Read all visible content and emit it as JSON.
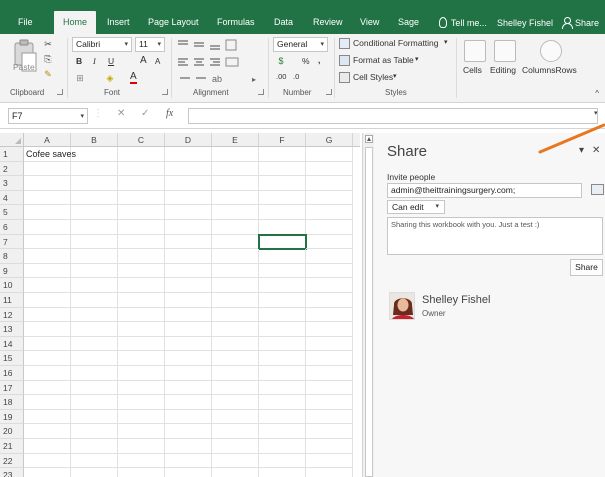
{
  "menubar": {
    "tabs": [
      {
        "label": "File"
      },
      {
        "label": "Home"
      },
      {
        "label": "Insert"
      },
      {
        "label": "Page Layout"
      },
      {
        "label": "Formulas"
      },
      {
        "label": "Data"
      },
      {
        "label": "Review"
      },
      {
        "label": "View"
      },
      {
        "label": "Sage"
      }
    ],
    "active_tab": "Home",
    "tell_me": "Tell me...",
    "user": "Shelley Fishel",
    "share_label": "Share",
    "accent_color": "#217346"
  },
  "ribbon": {
    "clipboard": {
      "paste_label": "Paste",
      "group_label": "Clipboard"
    },
    "font": {
      "font_name": "Calibri",
      "font_size": "11",
      "bold": "B",
      "italic": "I",
      "underline": "U",
      "grow": "A",
      "shrink": "A",
      "font_color_label": "A",
      "group_label": "Font"
    },
    "alignment": {
      "group_label": "Alignment"
    },
    "number": {
      "format": "General",
      "percent": "%",
      "comma": ",",
      "inc_dec": ".00",
      "dec_dec": ".0",
      "group_label": "Number"
    },
    "styles": {
      "conditional_formatting": "Conditional Formatting",
      "format_as_table": "Format as Table",
      "cell_styles": "Cell Styles",
      "group_label": "Styles"
    },
    "cells_label": "Cells",
    "editing_label": "Editing",
    "columnsrows_label": "ColumnsRows"
  },
  "formula_bar": {
    "name_box": "F7",
    "cancel_symbol": "✕",
    "enter_symbol": "✓",
    "fx_label": "fx",
    "formula": ""
  },
  "sheet": {
    "columns": [
      "A",
      "B",
      "C",
      "D",
      "E",
      "F",
      "G"
    ],
    "rows": [
      "1",
      "2",
      "3",
      "4",
      "5",
      "6",
      "7",
      "8",
      "9",
      "10",
      "11",
      "12",
      "13",
      "14",
      "15",
      "16",
      "17",
      "18",
      "19",
      "20",
      "21",
      "22",
      "23"
    ],
    "cells": {
      "A1": "Cofee saves"
    },
    "selected_cell": "F7"
  },
  "share_pane": {
    "title": "Share",
    "invite_label": "Invite people",
    "invite_value": "admin@theittrainingsurgery.com;",
    "permission": "Can edit",
    "message": "Sharing this workbook with you. Just a test :)",
    "share_button": "Share",
    "owner": {
      "name": "Shelley Fishel",
      "role": "Owner"
    },
    "pin_symbol": "▾",
    "close_symbol": "✕"
  },
  "annotation_arrow_color": "#e87722"
}
